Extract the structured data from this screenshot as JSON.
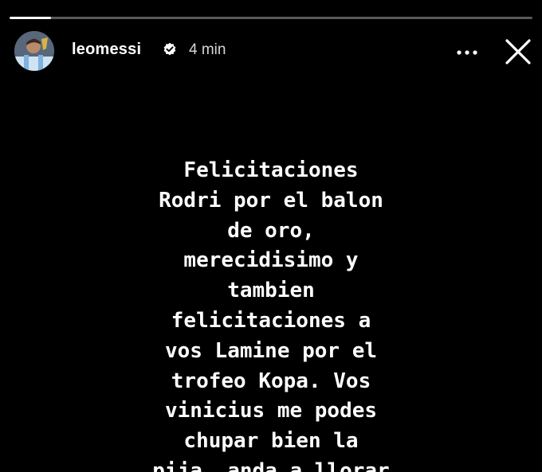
{
  "progress": {
    "fraction": 0.08
  },
  "header": {
    "username": "leomessi",
    "time": "4 min",
    "verified": true,
    "avatar_icon": "profile-avatar",
    "more_icon": "more-horizontal-icon",
    "close_icon": "close-icon"
  },
  "caption": {
    "lines": [
      "Felicitaciones",
      "Rodri por el balon",
      "de oro,",
      "merecidisimo y",
      "tambien",
      "felicitaciones a",
      "vos Lamine por el",
      "trofeo Kopa. Vos",
      "vinicius me podes",
      "chupar bien la",
      "pija, anda a llorar"
    ]
  },
  "colors": {
    "background": "#000000",
    "text": "#ffffff",
    "verified": "#ffffff"
  }
}
